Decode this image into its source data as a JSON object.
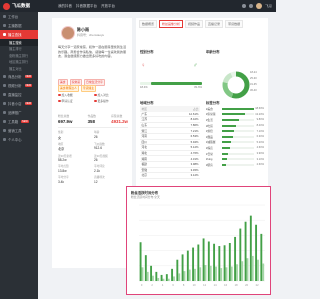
{
  "app": {
    "brand": "飞瓜数据",
    "top_menu": [
      "我的抖音",
      "抖音数据平台",
      "开放平台"
    ],
    "user_name": "飞瓜"
  },
  "sidebar": {
    "items": [
      {
        "label": "工作台",
        "active": false
      },
      {
        "label": "主播数据",
        "active": false
      },
      {
        "label": "播主查找",
        "active": true
      }
    ],
    "subs": [
      {
        "label": "播主搜索",
        "active": true
      },
      {
        "label": "播主排行",
        "active": false
      },
      {
        "label": "涨粉播主排行",
        "active": false
      },
      {
        "label": "地区播主排行",
        "active": false
      },
      {
        "label": "播主对比",
        "active": false
      }
    ],
    "more": [
      {
        "label": "商品分析",
        "badge": "NEW"
      },
      {
        "label": "视频分析",
        "badge": "NEW"
      },
      {
        "label": "直播监控",
        "badge": ""
      },
      {
        "label": "抖音小店",
        "badge": "NEW"
      },
      {
        "label": "品牌推广",
        "badge": ""
      },
      {
        "label": "工具箱",
        "badge": "NEW"
      },
      {
        "label": "营销工具",
        "badge": ""
      },
      {
        "label": "个人中心",
        "badge": ""
      }
    ]
  },
  "profile": {
    "name": "陈小雨",
    "meta": "抖音号：chenxiaoyu",
    "bio": "每天分享一道家常菜，和你一起在厨房里找到生活的乐趣。商务合作请私信，感谢每一位喜欢我的朋友，我会继续努力做出更多好吃的内容。",
    "tags": [
      "美食",
      "家常菜",
      "日常生活分享"
    ],
    "tags2": [
      "美食教程达人",
      "带货播主"
    ],
    "options": [
      "加入收藏",
      "加入对比",
      "申请认证",
      "更多操作"
    ],
    "stats": [
      {
        "label": "粉丝总数",
        "value": "697.9w",
        "red": false
      },
      {
        "label": "作品数",
        "value": "358",
        "red": false
      },
      {
        "label": "获赞总数",
        "value": "4931.2w",
        "red": true
      }
    ],
    "info": [
      [
        {
          "label": "性别",
          "value": "女"
        },
        {
          "label": "年龄",
          "value": "26"
        }
      ],
      [
        {
          "label": "地区",
          "value": "北京"
        },
        {
          "label": "飞瓜指数",
          "value": "912.6"
        }
      ],
      [
        {
          "label": "近30天新增",
          "value": "58.2w"
        },
        {
          "label": "近30天视频",
          "value": "26"
        }
      ],
      [
        {
          "label": "平均点赞",
          "value": "13.8w"
        },
        {
          "label": "平均评论",
          "value": "2.1k"
        }
      ],
      [
        {
          "label": "平均分享",
          "value": "3.4k"
        },
        {
          "label": "直播场次",
          "value": "12"
        }
      ]
    ]
  },
  "main": {
    "tabs": [
      {
        "label": "数据概览",
        "active": false
      },
      {
        "label": "粉丝画像分析",
        "active": true
      },
      {
        "label": "视频作品",
        "active": false
      },
      {
        "label": "直播记录",
        "active": false
      },
      {
        "label": "带货数据",
        "active": false
      }
    ],
    "gender_title": "性别分布",
    "gender_female_pct": "18.4%",
    "gender_male_pct": "81.6%",
    "age_title": "年龄分布",
    "age_labels": [
      "18-24",
      "25-30",
      "31-35",
      "36-40"
    ],
    "region_title": "地域分布",
    "region_head": [
      "地区",
      "占比"
    ],
    "regions": [
      {
        "name": "广东",
        "pct": "12.61%"
      },
      {
        "name": "江苏",
        "pct": "8.42%"
      },
      {
        "name": "山东",
        "pct": "7.86%"
      },
      {
        "name": "浙江",
        "pct": "7.21%"
      },
      {
        "name": "河南",
        "pct": "6.53%"
      },
      {
        "name": "四川",
        "pct": "5.94%"
      },
      {
        "name": "河北",
        "pct": "5.12%"
      },
      {
        "name": "湖北",
        "pct": "4.76%"
      },
      {
        "name": "湖南",
        "pct": "4.31%"
      },
      {
        "name": "福建",
        "pct": "3.98%"
      },
      {
        "name": "安徽",
        "pct": "3.45%"
      },
      {
        "name": "北京",
        "pct": "3.12%"
      }
    ],
    "tag_title": "标签分布",
    "tag_dist": [
      {
        "name": "#美食",
        "pct": "18.60%",
        "v": 1.0
      },
      {
        "name": "#家常菜",
        "pct": "13.20%",
        "v": 0.72
      },
      {
        "name": "#生活",
        "pct": "9.80%",
        "v": 0.54
      },
      {
        "name": "#吃货",
        "pct": "8.40%",
        "v": 0.46
      },
      {
        "name": "#烘焙",
        "pct": "7.10%",
        "v": 0.39
      },
      {
        "name": "#甜品",
        "pct": "6.30%",
        "v": 0.35
      },
      {
        "name": "#减脂餐",
        "pct": "5.20%",
        "v": 0.29
      },
      {
        "name": "#探店",
        "pct": "4.60%",
        "v": 0.25
      },
      {
        "name": "#日常",
        "pct": "3.90%",
        "v": 0.21
      },
      {
        "name": "#vlog",
        "pct": "3.10%",
        "v": 0.17
      },
      {
        "name": "#厨房",
        "pct": "2.60%",
        "v": 0.14
      }
    ],
    "colors": {
      "accent": "#e53935",
      "green": "#43a047",
      "light_green": "#c8e6c9",
      "highlight": "#e0447a"
    }
  },
  "activity": {
    "title": "粉丝活跃时间分布",
    "subtitle": "粉丝活跃时间分布 全天"
  },
  "chart_data": {
    "type": "bar",
    "title": "粉丝活跃时间分布",
    "categories": [
      "0",
      "1",
      "2",
      "3",
      "4",
      "5",
      "6",
      "7",
      "8",
      "9",
      "10",
      "11",
      "12",
      "13",
      "14",
      "15",
      "16",
      "17",
      "18",
      "19",
      "20",
      "21",
      "22",
      "23"
    ],
    "series": [
      {
        "values": [
          5.1,
          3.4,
          2.0,
          1.2,
          0.8,
          0.9,
          1.6,
          2.8,
          3.5,
          4.0,
          4.4,
          4.8,
          5.6,
          5.2,
          4.9,
          4.6,
          4.7,
          5.0,
          5.8,
          6.9,
          7.8,
          8.6,
          7.4,
          6.2
        ]
      },
      {
        "values": [
          1.8,
          1.2,
          0.7,
          0.4,
          0.3,
          0.3,
          0.6,
          1.0,
          1.3,
          1.5,
          1.6,
          1.8,
          2.1,
          2.0,
          1.9,
          1.7,
          1.8,
          1.9,
          2.2,
          2.6,
          3.0,
          3.3,
          2.8,
          2.3
        ]
      }
    ],
    "ylim": [
      0,
      10
    ],
    "grid": true,
    "legend": "none"
  }
}
